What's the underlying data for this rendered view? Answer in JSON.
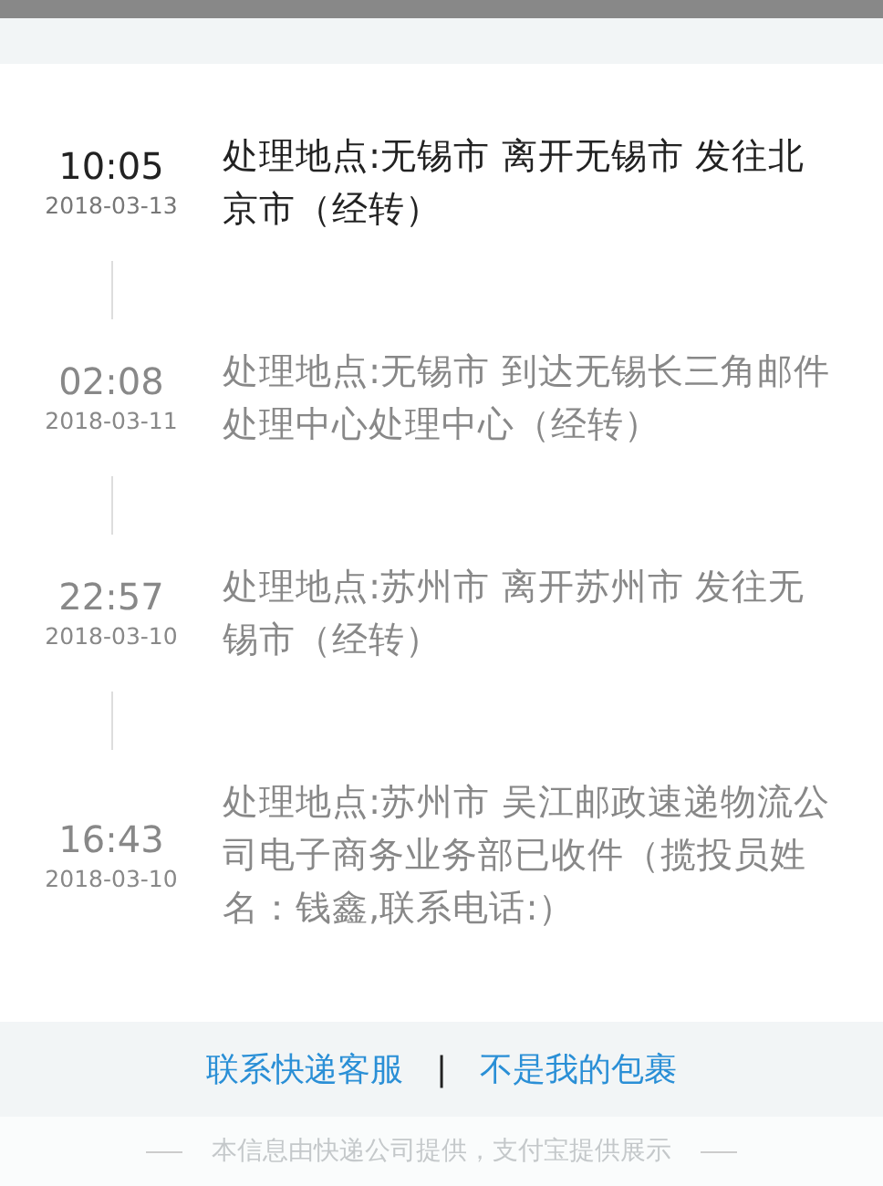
{
  "events": [
    {
      "time": "10:05",
      "date": "2018-03-13",
      "text": "处理地点:无锡市 离开无锡市 发往北京市（经转）",
      "latest": true
    },
    {
      "time": "02:08",
      "date": "2018-03-11",
      "text": "处理地点:无锡市 到达无锡长三角邮件处理中心处理中心（经转）",
      "latest": false
    },
    {
      "time": "22:57",
      "date": "2018-03-10",
      "text": "处理地点:苏州市 离开苏州市 发往无锡市（经转）",
      "latest": false
    },
    {
      "time": "16:43",
      "date": "2018-03-10",
      "text": "处理地点:苏州市 吴江邮政速递物流公司电子商务业务部已收件（揽投员姓名：钱鑫,联系电话:）",
      "latest": false
    }
  ],
  "links": [
    "联系快递客服",
    "不是我的包裹"
  ],
  "separator": "|",
  "footer": "本信息由快递公司提供，支付宝提供展示"
}
